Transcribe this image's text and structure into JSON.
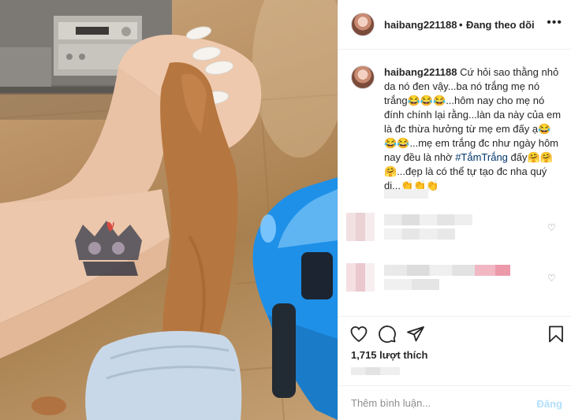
{
  "post": {
    "username": "haibang221188",
    "separator": "•",
    "follow_status": "Đang theo dõi",
    "more_label": "•••"
  },
  "caption": {
    "username": "haibang221188",
    "text_before_tag": "Cứ hỏi sao thằng nhỏ da nó đen vậy...ba nó trắng mẹ nó trắng😂😂😂...hôm nay cho mẹ nó đính chính lại rằng...làn da này của em là đc thừa hưởng từ mẹ em đấy ạ😂😂😂...mẹ em trắng đc như ngày hôm nay đều là nhờ ",
    "hashtag": "#TắmTrắng",
    "text_after_tag": " đấy🤗🤗🤗...đẹp là có thể tự tạo đc nha quý dị...👏👏👏"
  },
  "icons": {
    "like": "heart-icon",
    "comment": "comment-bubble-icon",
    "share": "paper-plane-icon",
    "save": "bookmark-icon",
    "comment_like": "small-heart-icon",
    "more": "more-dots-icon"
  },
  "stats": {
    "likes_text": "1,715 lượt thích"
  },
  "comment_box": {
    "placeholder": "Thêm bình luận...",
    "post_label": "Đăng"
  },
  "colors": {
    "text": "#262626",
    "secondary": "#8e8e8e",
    "hashtag": "#003569",
    "post_button_disabled": "#b2dffc",
    "border": "#efefef"
  }
}
